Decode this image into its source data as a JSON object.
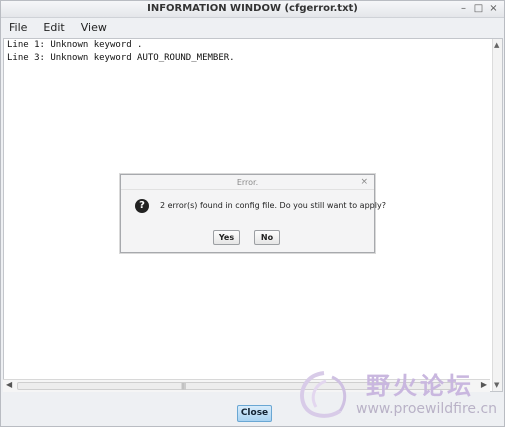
{
  "window": {
    "title": "INFORMATION  WINDOW (cfgerror.txt)",
    "controls": {
      "minimize": "–",
      "maximize": "□",
      "close": "×"
    }
  },
  "menu": {
    "file": "File",
    "edit": "Edit",
    "view": "View"
  },
  "content": {
    "lines": [
      "Line 1: Unknown keyword .",
      "Line 3: Unknown keyword AUTO_ROUND_MEMBER."
    ]
  },
  "footer": {
    "close_label": "Close"
  },
  "dialog": {
    "title": "Error.",
    "close": "×",
    "icon": "question-icon",
    "icon_glyph": "?",
    "message": "2 error(s) found in config file. Do you still want to apply?",
    "yes_label": "Yes",
    "no_label": "No"
  },
  "watermark": {
    "text": "野火论坛",
    "url": "www.proewildfire.cn"
  },
  "colors": {
    "close_button": "#a9d3f2",
    "watermark": "#c9b7df"
  }
}
